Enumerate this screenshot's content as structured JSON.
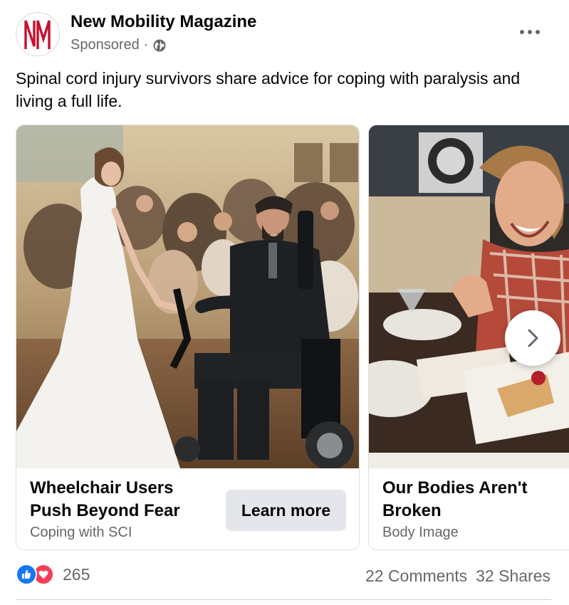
{
  "post": {
    "page_name": "New Mobility Magazine",
    "sponsored_label": "Sponsored",
    "separator": "·",
    "privacy_icon": "globe-icon",
    "more_icon": "more-options-icon",
    "caption": "Spinal cord injury survivors share advice for coping with paralysis and living a full life.",
    "logo_text": "NM",
    "logo_color": "#c8102e"
  },
  "carousel": {
    "cards": [
      {
        "image_desc": "bride-and-groom-in-wheelchair-photo",
        "title": "Wheelchair Users Push Beyond Fear",
        "subtitle": "Coping with SCI",
        "cta": "Learn more"
      },
      {
        "image_desc": "smiling-woman-with-dessert-photo",
        "title": "Our Bodies Aren't Broken",
        "subtitle": "Body Image"
      }
    ],
    "next_icon": "chevron-right-icon"
  },
  "footer": {
    "reaction_count": "265",
    "comments": "22 Comments",
    "shares": "32 Shares",
    "like_color": "#1877f2",
    "love_color": "#f33e58"
  }
}
